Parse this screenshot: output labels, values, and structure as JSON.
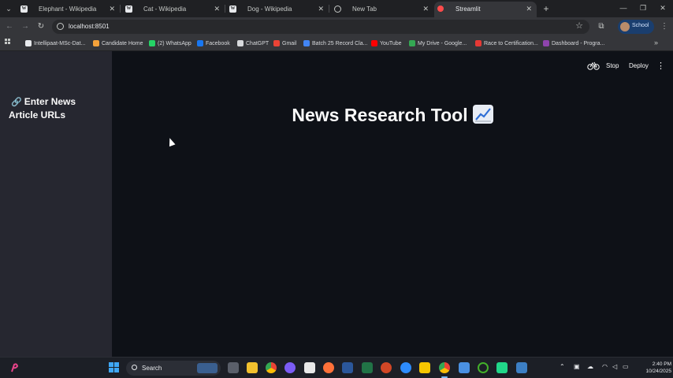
{
  "browser": {
    "tabs": [
      {
        "title": "Elephant - Wikipedia",
        "favicon": "wikipedia-icon",
        "active": false
      },
      {
        "title": "Cat - Wikipedia",
        "favicon": "wikipedia-icon",
        "active": false
      },
      {
        "title": "Dog - Wikipedia",
        "favicon": "wikipedia-icon",
        "active": false
      },
      {
        "title": "New Tab",
        "favicon": "globe-icon",
        "active": false
      },
      {
        "title": "Streamlit",
        "favicon": "streamlit-icon",
        "active": true
      }
    ],
    "url": "localhost:8501",
    "profile_label": "School",
    "bookmarks": [
      {
        "label": "Intellipaat-MSc-Dat...",
        "icon": "github-icon",
        "color": "#e8eaed"
      },
      {
        "label": "Candidate Home",
        "icon": "candidate-icon",
        "color": "#f4a23a"
      },
      {
        "label": "(2) WhatsApp",
        "icon": "whatsapp-icon",
        "color": "#25d366"
      },
      {
        "label": "Facebook",
        "icon": "facebook-icon",
        "color": "#1877f2"
      },
      {
        "label": "ChatGPT",
        "icon": "chatgpt-icon",
        "color": "#d7d9dc"
      },
      {
        "label": "Gmail",
        "icon": "gmail-icon",
        "color": "#ea4335"
      },
      {
        "label": "Batch 25 Record Cla...",
        "icon": "record-icon",
        "color": "#4285f4"
      },
      {
        "label": "YouTube",
        "icon": "youtube-icon",
        "color": "#ff0000"
      },
      {
        "label": "My Drive - Google...",
        "icon": "drive-icon",
        "color": "#34a853"
      },
      {
        "label": "Race to Certification...",
        "icon": "race-icon",
        "color": "#e53935"
      },
      {
        "label": "Dashboard - Progra...",
        "icon": "dashboard-icon",
        "color": "#8e44ad"
      }
    ]
  },
  "streamlit": {
    "sidebar_title": "Enter News Article URLs",
    "sidebar_icon": "link-icon",
    "main_title": "News Research Tool",
    "title_icon": "chart-increasing-icon",
    "header": {
      "stop_label": "Stop",
      "deploy_label": "Deploy",
      "running_icon": "bicycle-icon"
    }
  },
  "taskbar": {
    "search_placeholder": "Search",
    "time": "2:40 PM",
    "date": "10/24/2025"
  },
  "colors": {
    "sidebar_bg": "#262730",
    "main_bg": "#0e1117",
    "text": "#fafafa",
    "chrome_tab_strip": "#1f2023",
    "chrome_toolbar": "#35363a"
  }
}
